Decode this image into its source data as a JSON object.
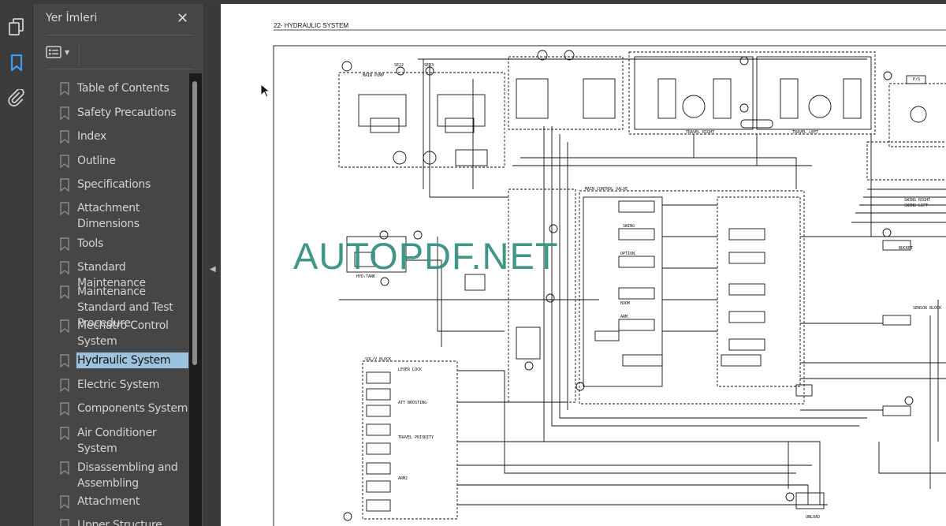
{
  "sidebar": {
    "title": "Yer İmleri",
    "rail_icons": [
      "pages-icon",
      "bookmark-icon",
      "attachment-icon"
    ],
    "items": [
      {
        "label": "Table of Contents"
      },
      {
        "label": "Safety Precautions"
      },
      {
        "label": "Index"
      },
      {
        "label": "Outline"
      },
      {
        "label": "Specifications"
      },
      {
        "label": "Attachment Dimensions"
      },
      {
        "label": "Tools"
      },
      {
        "label": "Standard Maintenance"
      },
      {
        "label": "Maintenance Standard and Test Procedure"
      },
      {
        "label": "Mechatro Control System"
      },
      {
        "label": "Hydraulic System",
        "selected": true
      },
      {
        "label": "Electric System"
      },
      {
        "label": "Components System"
      },
      {
        "label": "Air Conditioner System"
      },
      {
        "label": "Disassembling and Assembling"
      },
      {
        "label": "Attachment"
      },
      {
        "label": "Upper Structure"
      }
    ],
    "selected_color": "#9dc2de"
  },
  "document": {
    "header": "22- HYDRAULIC SYSTEM",
    "watermark": "AUTOPDF.NET",
    "labels": {
      "main_pump": "MAIN PUMP",
      "main_control_valve": "MAIN CONTROL VALVE",
      "hyd_tank": "HYD.TANK",
      "travel_right": "TRAVEL RIGHT",
      "travel_left": "TRAVEL LEFT",
      "sol_block": "SOL/V BLOCK",
      "swing": "SWING",
      "option": "OPTION",
      "boom": "BOOM",
      "arm": "ARM",
      "bucket": "BUCKET",
      "unload": "UNLOAD",
      "se22": "SE22",
      "se23": "SE23",
      "lever_lock": "LEVER LOCK",
      "travel_priority": "TRAVEL PRIORITY",
      "att_boosting": "ATT BOOSTING",
      "arm2": "ARM2",
      "sensor_block": "SENSOR BLOCK",
      "pcv": "P/S",
      "swing_right": "SWING RIGHT",
      "swing_left": "SWING LEFT"
    }
  }
}
